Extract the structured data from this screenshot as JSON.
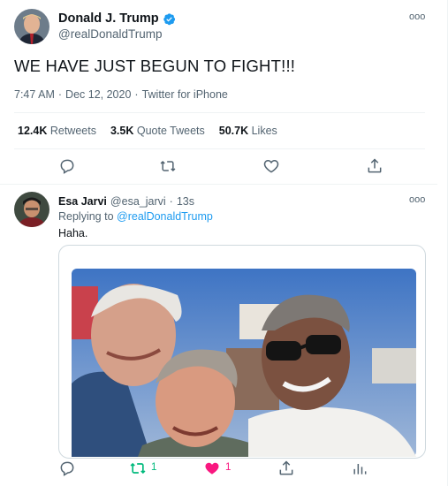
{
  "main_tweet": {
    "author_name": "Donald J. Trump",
    "author_handle": "@realDonaldTrump",
    "text": "WE HAVE JUST BEGUN TO FIGHT!!!",
    "time": "7:47 AM",
    "date": "Dec 12, 2020",
    "source": "Twitter for iPhone",
    "meta_sep": "·",
    "retweets": {
      "count": "12.4K",
      "label": "Retweets"
    },
    "quote_tweets": {
      "count": "3.5K",
      "label": "Quote Tweets"
    },
    "likes": {
      "count": "50.7K",
      "label": "Likes"
    },
    "more": "ooo"
  },
  "reply": {
    "author_name": "Esa Jarvi",
    "author_handle": "@esa_jarvi",
    "sep": "·",
    "age": "13s",
    "replying_prefix": "Replying to",
    "replying_to": "@realDonaldTrump",
    "text": "Haha.",
    "retweet_count": "1",
    "like_count": "1",
    "more": "ooo"
  },
  "colors": {
    "accent": "#1d9bf0",
    "retweet_green": "#00ba7c",
    "like_pink": "#f91880",
    "muted": "#536471",
    "border": "#eff3f4"
  },
  "icons": {
    "verified": "verified-badge-icon",
    "reply": "reply-icon",
    "retweet": "retweet-icon",
    "like": "heart-icon",
    "share": "share-icon",
    "analytics": "analytics-icon",
    "more": "more-icon"
  }
}
